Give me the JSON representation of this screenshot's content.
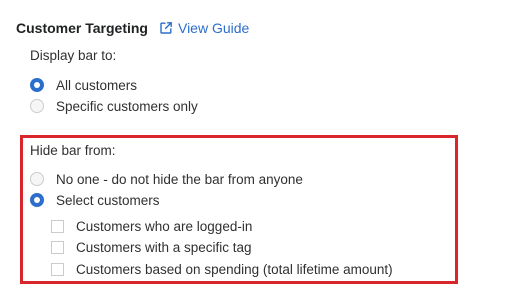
{
  "header": {
    "title": "Customer Targeting",
    "guide_link": "View Guide",
    "link_color": "#2c6ecb"
  },
  "display_bar": {
    "label": "Display bar to:",
    "options": [
      {
        "label": "All customers",
        "selected": true
      },
      {
        "label": "Specific customers only",
        "selected": false
      }
    ]
  },
  "hide_bar": {
    "label": "Hide bar from:",
    "highlight_color": "#d9262d",
    "options": [
      {
        "label": "No one - do not hide the bar from anyone",
        "selected": false
      },
      {
        "label": "Select customers",
        "selected": true
      }
    ],
    "checkboxes": [
      {
        "label": "Customers who are logged-in",
        "checked": false
      },
      {
        "label": "Customers with a specific tag",
        "checked": false
      },
      {
        "label": "Customers based on spending (total lifetime amount)",
        "checked": false
      }
    ]
  }
}
